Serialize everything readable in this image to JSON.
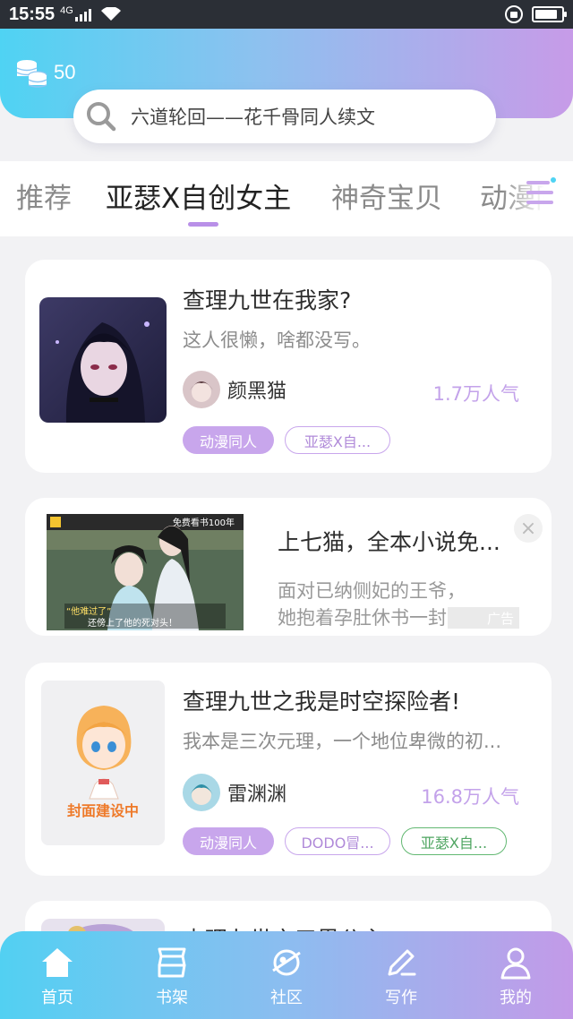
{
  "status_bar": {
    "time": "15:55",
    "network": "4G"
  },
  "coins": {
    "count": "50",
    "icon": "coin-stack-icon"
  },
  "search": {
    "placeholder": "六道轮回——花千骨同人续文",
    "icon": "search-icon"
  },
  "tabs": [
    {
      "label": "推荐",
      "active": false
    },
    {
      "label": "亚瑟X自创女主",
      "active": true
    },
    {
      "label": "神奇宝贝",
      "active": false
    },
    {
      "label": "动漫同人",
      "active": false
    }
  ],
  "colors": {
    "accent": "#c8a6ec",
    "header_start": "#4fd3f3",
    "header_end": "#c79be8",
    "green_tag": "#62b872"
  },
  "stories": [
    {
      "title": "查理九世在我家?",
      "description": "这人很懒，啥都没写。",
      "author": "颜黑猫",
      "popularity": "1.7万人气",
      "tags": [
        "动漫同人",
        "亚瑟X自..."
      ]
    },
    {
      "title": "查理九世之我是时空探险者!",
      "description": "我本是三次元理，一个地位卑微的初...",
      "author": "雷渊渊",
      "popularity": "16.8万人气",
      "cover_text": "封面建设中",
      "tags": [
        "动漫同人",
        "DODO冒...",
        "亚瑟X自..."
      ]
    },
    {
      "title": "查理九世之五界公主"
    }
  ],
  "ad": {
    "title": "上七猫，全本小说免...",
    "description_line1": "面对已纳侧妃的王爷，",
    "description_line2": "她抱着孕肚休书一封",
    "badge": "广告",
    "close": "×",
    "image_brand": "免费看书100年",
    "image_caption1": "“他难过了”",
    "image_caption2": "还傍上了他的死对头！"
  },
  "bottom_nav": [
    {
      "label": "首页",
      "icon": "home-icon",
      "active": true
    },
    {
      "label": "书架",
      "icon": "bookshelf-icon",
      "active": false
    },
    {
      "label": "社区",
      "icon": "planet-icon",
      "active": false
    },
    {
      "label": "写作",
      "icon": "pen-icon",
      "active": false
    },
    {
      "label": "我的",
      "icon": "profile-icon",
      "active": false
    }
  ]
}
